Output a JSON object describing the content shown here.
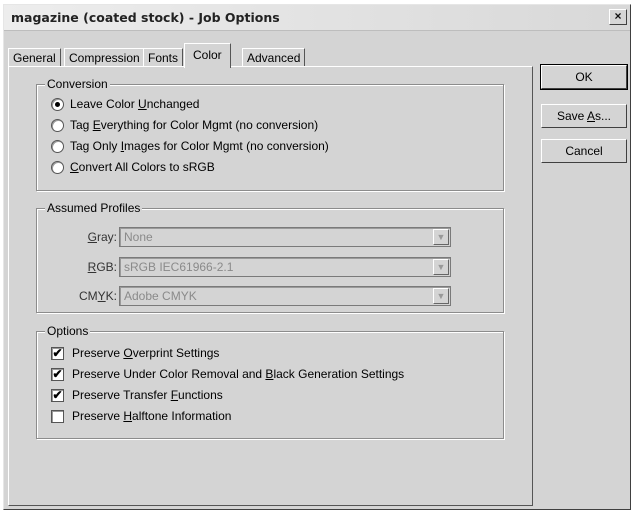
{
  "window": {
    "title": "magazine (coated stock) - Job Options",
    "close_label": "×"
  },
  "tabs": [
    {
      "label": "General"
    },
    {
      "label": "Compression"
    },
    {
      "label": "Fonts"
    },
    {
      "label": "Color",
      "active": true
    },
    {
      "label": "Advanced"
    }
  ],
  "conversion": {
    "title": "Conversion",
    "options": [
      {
        "pre": "Leave Color ",
        "u": "U",
        "post": "nchanged",
        "selected": true
      },
      {
        "pre": "Tag ",
        "u": "E",
        "post": "verything for Color Mgmt (no conversion)",
        "selected": false
      },
      {
        "pre": "Tag Only ",
        "u": "I",
        "post": "mages for Color Mgmt (no conversion)",
        "selected": false
      },
      {
        "pre": "",
        "u": "C",
        "post": "onvert All Colors to sRGB",
        "selected": false
      }
    ]
  },
  "profiles": {
    "title": "Assumed Profiles",
    "gray": {
      "pre": "",
      "u": "G",
      "post": "ray:",
      "value": "None"
    },
    "rgb": {
      "pre": "",
      "u": "R",
      "post": "GB:",
      "value": "sRGB IEC61966-2.1"
    },
    "cmyk": {
      "pre": "CM",
      "u": "Y",
      "post": "K:",
      "value": "Adobe CMYK"
    },
    "arrow": "▼"
  },
  "options": {
    "title": "Options",
    "items": [
      {
        "pre": "Preserve ",
        "u": "O",
        "post": "verprint Settings",
        "checked": true
      },
      {
        "pre": "Preserve Under Color Removal and ",
        "u": "B",
        "post": "lack Generation Settings",
        "checked": true
      },
      {
        "pre": "Preserve Transfer ",
        "u": "F",
        "post": "unctions",
        "checked": true
      },
      {
        "pre": "Preserve ",
        "u": "H",
        "post": "alftone Information",
        "checked": false
      }
    ],
    "check_mark": "✔"
  },
  "buttons": {
    "ok": "OK",
    "save_as": {
      "pre": "Save ",
      "u": "A",
      "post": "s..."
    },
    "cancel": "Cancel"
  }
}
